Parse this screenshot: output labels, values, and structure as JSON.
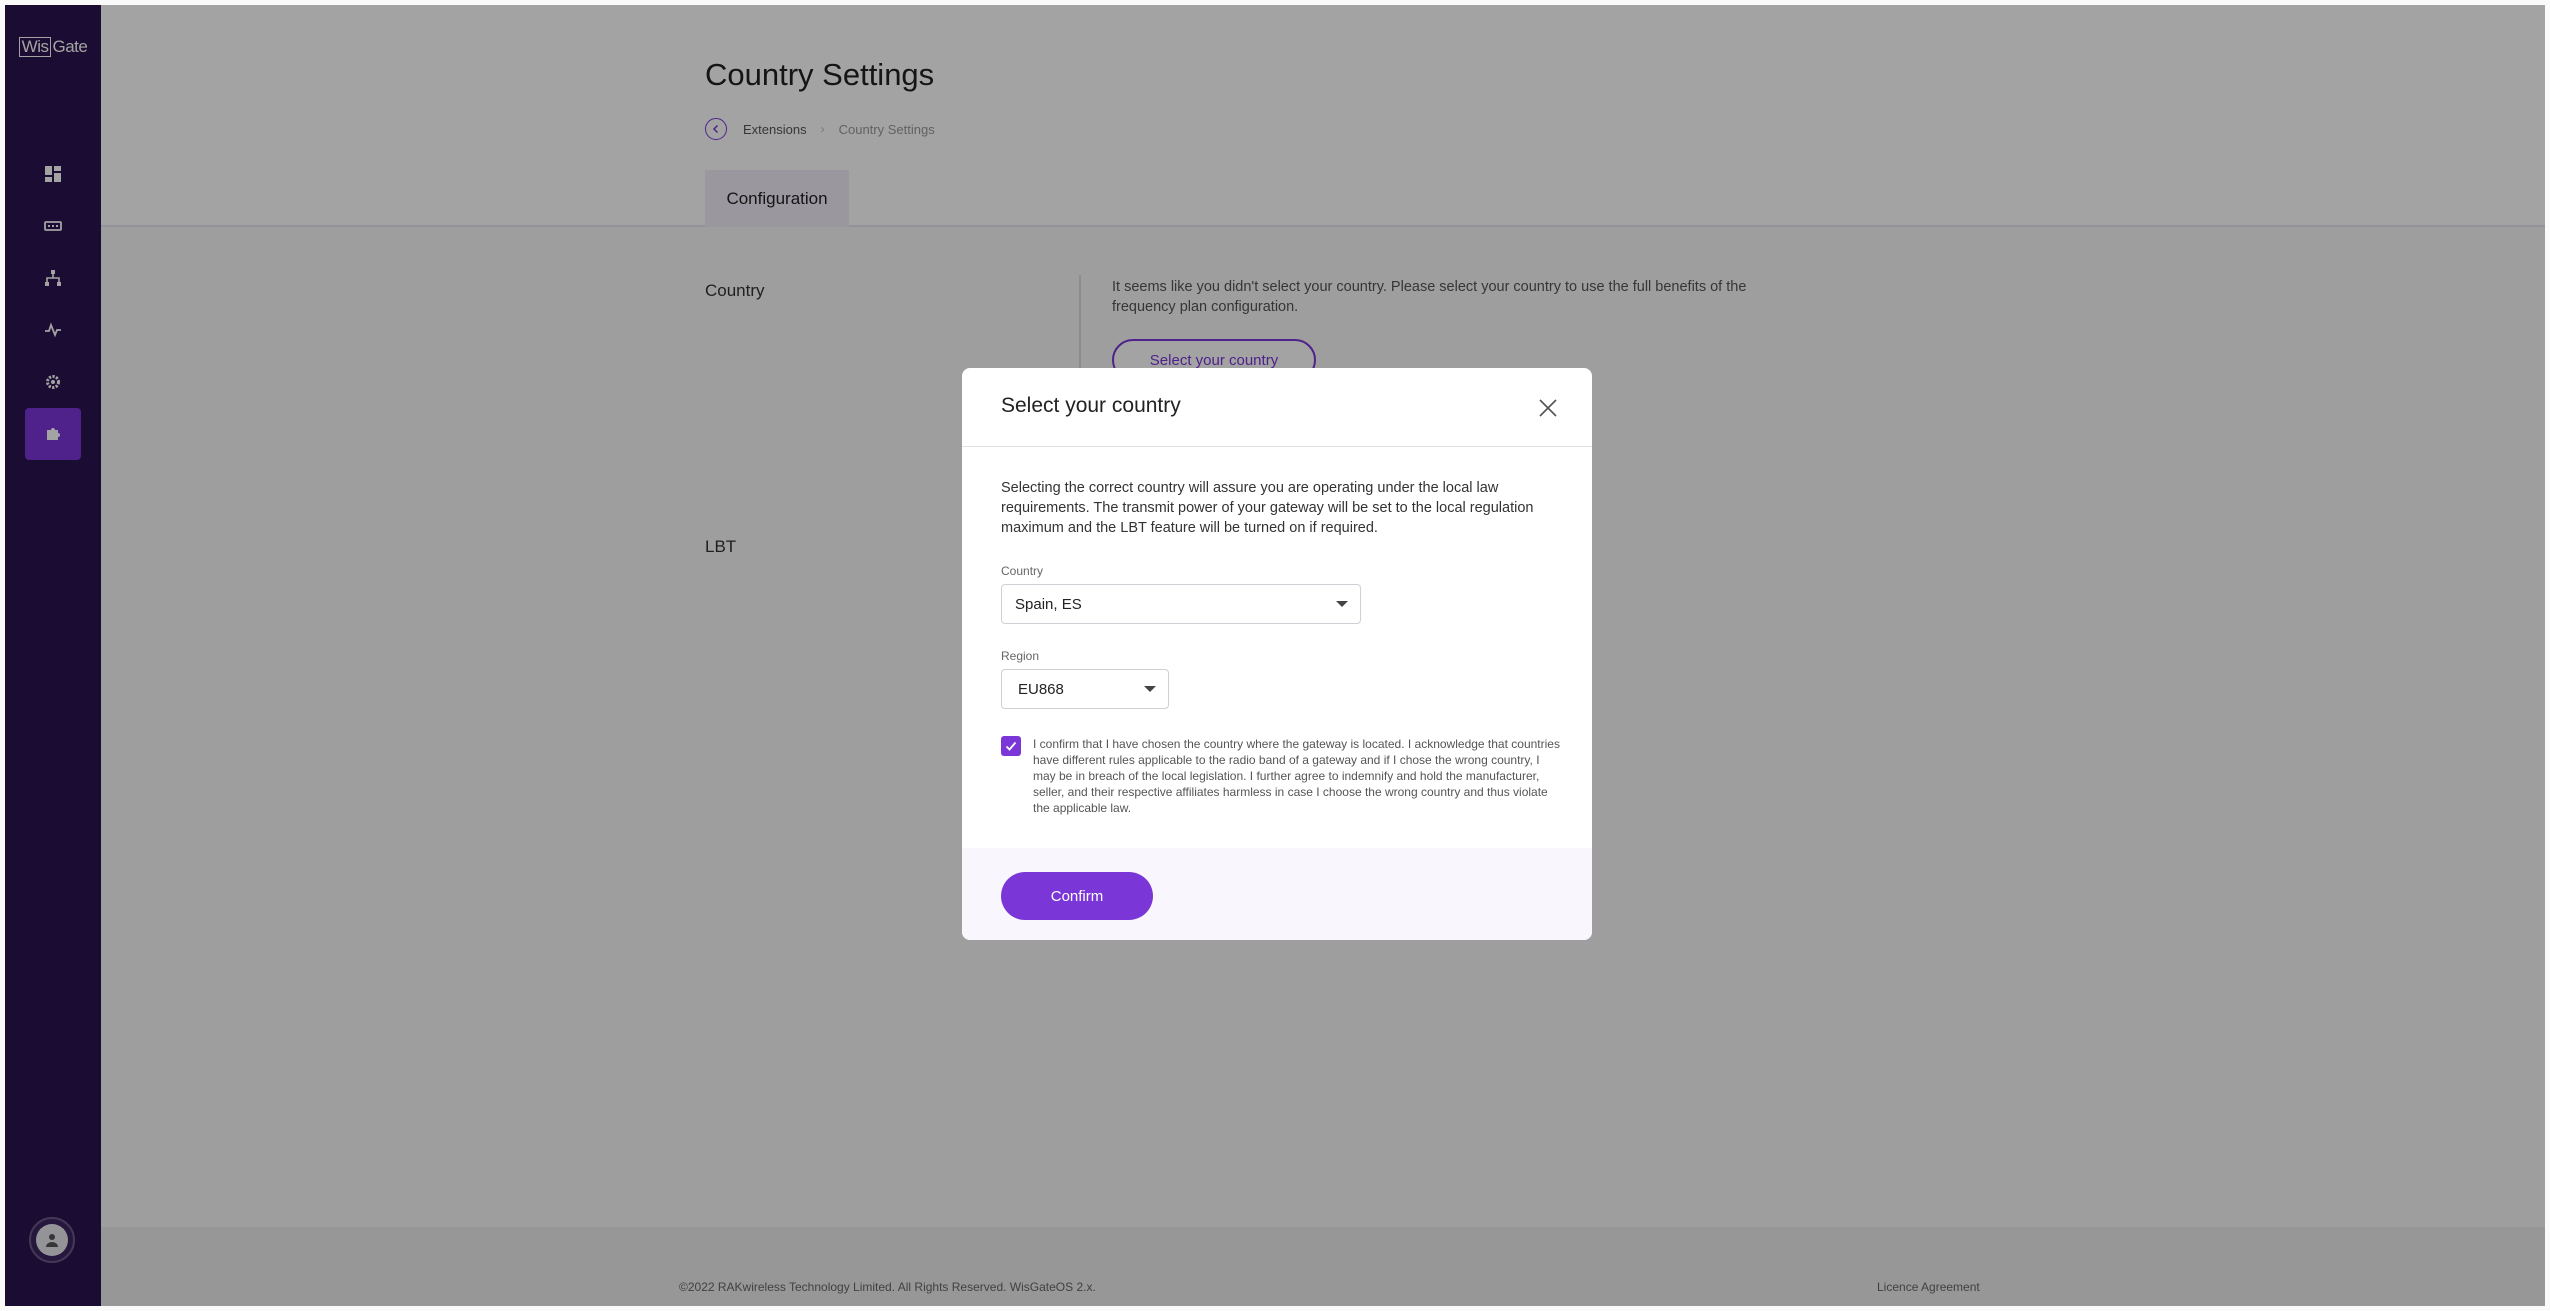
{
  "sidebar": {
    "logo_left": "Wis",
    "logo_right": "Gate",
    "items": [
      {
        "name": "dashboard",
        "active": false
      },
      {
        "name": "gateway",
        "active": false
      },
      {
        "name": "network",
        "active": false
      },
      {
        "name": "activity",
        "active": false
      },
      {
        "name": "settings",
        "active": false
      },
      {
        "name": "extensions",
        "active": true
      }
    ]
  },
  "page": {
    "title": "Country Settings",
    "breadcrumb": [
      "Extensions",
      "Country Settings"
    ],
    "tabs": [
      {
        "label": "Configuration"
      }
    ]
  },
  "country_section": {
    "label": "Country",
    "warning": "It seems like you didn't select your country. Please select your country to use the full benefits of the frequency plan configuration.",
    "button": "Select your country"
  },
  "lbt_section": {
    "label": "LBT"
  },
  "modal": {
    "title": "Select your country",
    "description": "Selecting the correct country will assure you are operating under the local law requirements. The transmit power of your gateway will be set to the local regulation maximum and the LBT feature will be turned on if required.",
    "country_label": "Country",
    "country_value": "Spain, ES",
    "region_label": "Region",
    "region_value": "EU868",
    "confirm_checked": true,
    "confirm_text": "I confirm that I have chosen the country where the gateway is located. I acknowledge that countries have different rules applicable to the radio band of a gateway and if I chose the wrong country, I may be in breach of the local legislation. I further agree to indemnify and hold the manufacturer, seller, and their respective affiliates harmless in case I choose the wrong country and thus violate the applicable law.",
    "confirm_button": "Confirm"
  },
  "footer": {
    "copyright": "©2022 RAKwireless Technology Limited. All Rights Reserved. WisGateOS 2.x.",
    "licence_link": "Licence Agreement"
  },
  "colors": {
    "sidebar": "#2b1450",
    "accent": "#7b36d8"
  }
}
